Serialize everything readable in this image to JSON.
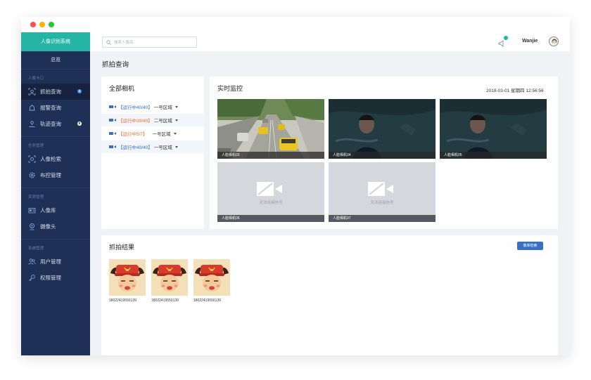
{
  "app": {
    "name": "人像识别系统"
  },
  "sidebar": {
    "overview": "总览",
    "groups": [
      {
        "label": "人像卡口",
        "items": [
          {
            "label": "抓拍查询",
            "icon": "face-scan-icon",
            "badge": "1",
            "active": true
          },
          {
            "label": "报警查询",
            "icon": "alarm-icon",
            "badge": null
          },
          {
            "label": "轨迹查询",
            "icon": "track-icon",
            "badge": "8"
          }
        ]
      },
      {
        "label": "任务管理",
        "items": [
          {
            "label": "人像检索",
            "icon": "face-search-icon"
          },
          {
            "label": "布控管理",
            "icon": "gear-icon"
          }
        ]
      },
      {
        "label": "资源管理",
        "items": [
          {
            "label": "人像库",
            "icon": "id-card-icon"
          },
          {
            "label": "摄像头",
            "icon": "camera-icon"
          }
        ]
      },
      {
        "label": "系统管理",
        "items": [
          {
            "label": "用户管理",
            "icon": "users-icon"
          },
          {
            "label": "权限管理",
            "icon": "key-icon"
          }
        ]
      }
    ]
  },
  "topbar": {
    "search_placeholder": "搜索人像库...",
    "username": "Wanjie"
  },
  "page": {
    "title": "抓拍查询"
  },
  "cameras": {
    "title": "全部相机",
    "items": [
      {
        "status": "【运行中40/40】",
        "zone": "一号区域",
        "status_color": "#2f6fd1"
      },
      {
        "status": "【运行中39/40】",
        "zone": "二号区域",
        "status_color": "#f26c2d"
      },
      {
        "status": "【运行中5/7】",
        "zone": "一号区域",
        "status_color": "#f26c2d"
      },
      {
        "status": "【运行中40/40】",
        "zone": "一号区域",
        "status_color": "#2f6fd1"
      }
    ]
  },
  "monitor": {
    "title": "实时监控",
    "datetime": "2018-03-01 星期四 12:56:56",
    "feeds": [
      {
        "label": "人脸相机03",
        "kind": "street"
      },
      {
        "label": "人脸相机04",
        "kind": "movie"
      },
      {
        "label": "人脸相机05",
        "kind": "movie"
      },
      {
        "label": "人脸相机06",
        "kind": "nosignal",
        "message": "无法连接信号"
      },
      {
        "label": "人脸相机07",
        "kind": "nosignal",
        "message": "无法连接信号"
      }
    ]
  },
  "results": {
    "title": "抓拍结果",
    "button": "像库检索",
    "items": [
      {
        "id": "18022419550139"
      },
      {
        "id": "18022419550139"
      },
      {
        "id": "18022419550139"
      }
    ]
  }
}
